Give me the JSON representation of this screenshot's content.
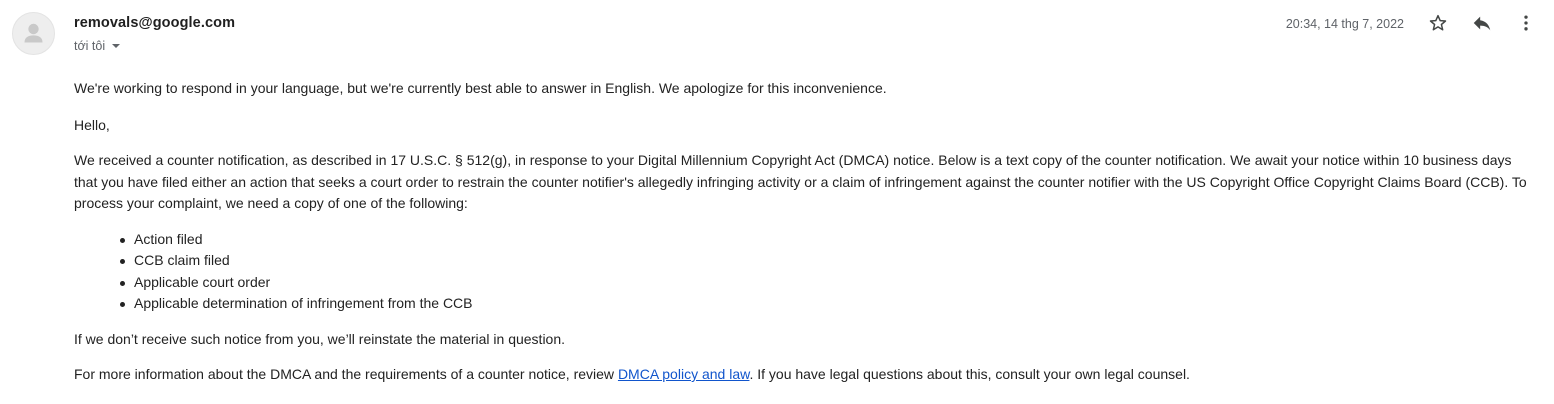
{
  "header": {
    "sender": "removals@google.com",
    "recipient": "tới tôi",
    "timestamp": "20:34, 14 thg 7, 2022",
    "icons": {
      "avatar": "person-icon",
      "star": "star-icon",
      "reply": "reply-icon",
      "more": "more-vert-icon"
    }
  },
  "body": {
    "intro": "We're working to respond in your language, but we're currently best able to answer in English. We apologize for this inconvenience.",
    "greeting": "Hello,",
    "main": "We received a counter notification, as described in 17 U.S.C. § 512(g), in response to your Digital Millennium Copyright Act (DMCA) notice. Below is a text copy of the counter notification. We await your notice within 10 business days that you have filed either an action that seeks a court order to restrain the counter notifier's allegedly infringing activity or a claim of infringement against the counter notifier with the US Copyright Office Copyright Claims Board (CCB). To process your complaint, we need a copy of one of the following:",
    "bullets": [
      "Action filed",
      "CCB claim filed",
      "Applicable court order",
      "Applicable determination of infringement from the CCB"
    ],
    "reinstate": "If we don’t receive such notice from you, we’ll reinstate the material in question.",
    "more_info_prefix": "For more information about the DMCA and the requirements of a counter notice, review ",
    "more_info_link": "DMCA policy and law",
    "more_info_suffix": ". If you have legal questions about this, consult your own legal counsel."
  },
  "colors": {
    "link": "#1155cc",
    "text": "#222222",
    "secondary": "#5f6368"
  }
}
